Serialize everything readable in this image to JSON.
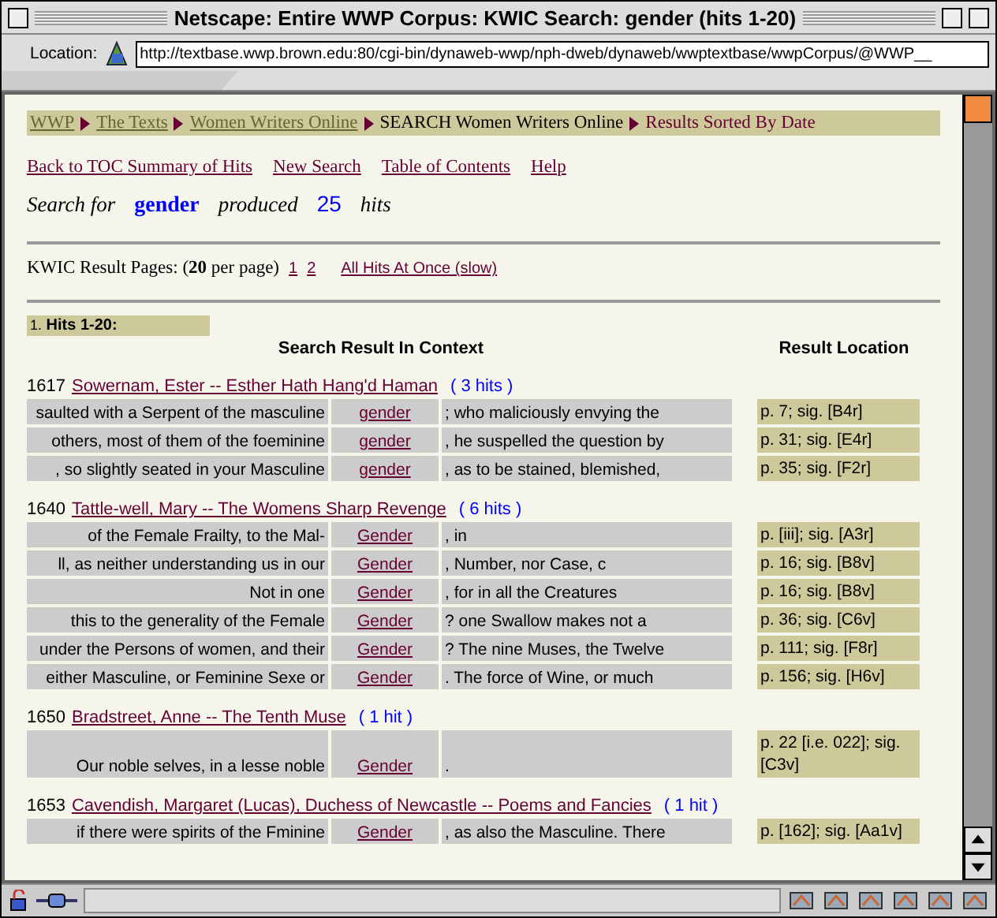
{
  "window": {
    "title": "Netscape: Entire WWP Corpus: KWIC Search: gender (hits 1-20)"
  },
  "location": {
    "label": "Location:",
    "url": "http://textbase.wwp.brown.edu:80/cgi-bin/dynaweb-wwp/nph-dweb/dynaweb/wwptextbase/wwpCorpus/@WWP__"
  },
  "breadcrumb": [
    {
      "label": "WWP",
      "kind": "link"
    },
    {
      "label": "The Texts",
      "kind": "link"
    },
    {
      "label": "Women Writers Online",
      "kind": "link"
    },
    {
      "label": "SEARCH Women Writers Online",
      "kind": "text"
    },
    {
      "label": "Results Sorted By Date",
      "kind": "current"
    }
  ],
  "nav_links": [
    "Back to TOC Summary of Hits",
    "New Search",
    "Table of Contents",
    "Help"
  ],
  "search_summary": {
    "prefix": "Search for",
    "term": "gender",
    "middle": "produced",
    "count": "25",
    "suffix": "hits"
  },
  "result_pages": {
    "label": "KWIC Result Pages: (**20** per page)",
    "pages": [
      "1",
      "2"
    ],
    "all_link": "All Hits At Once (slow)"
  },
  "section": {
    "number": "1.",
    "title": "Hits 1-20:"
  },
  "headers": {
    "context": "Search Result In Context",
    "location": "Result Location"
  },
  "groups": [
    {
      "year": "1617",
      "title": "Sowernam, Ester -- Esther Hath Hang'd Haman",
      "hits": "( 3 hits )",
      "rows": [
        {
          "before": "saulted with a Serpent of the masculine",
          "keyword": "gender",
          "after": "; who maliciously envying the",
          "location": "p. 7; sig. [B4r]"
        },
        {
          "before": "others, most of them of the foeminine",
          "keyword": "gender",
          "after": ", he suspelled the question by",
          "location": "p. 31; sig. [E4r]"
        },
        {
          "before": ", so slightly seated in your Masculine",
          "keyword": "gender",
          "after": ", as to be stained, blemished,",
          "location": "p. 35; sig. [F2r]"
        }
      ]
    },
    {
      "year": "1640",
      "title": "Tattle-well, Mary -- The Womens Sharp Revenge",
      "hits": "( 6 hits )",
      "rows": [
        {
          "before": "of the Female Frailty, to the Mal-",
          "keyword": "Gender",
          "after": ", in",
          "location": "p. [iii]; sig. [A3r]"
        },
        {
          "before": "ll, as neither understanding us in our",
          "keyword": "Gender",
          "after": ", Number, nor Case, c",
          "location": "p. 16; sig. [B8v]"
        },
        {
          "before": "Not in one",
          "keyword": "Gender",
          "after": ", for in all the Creatures",
          "location": "p. 16; sig. [B8v]"
        },
        {
          "before": "this to the generality of the Female",
          "keyword": "Gender",
          "after": "? one Swallow makes not a",
          "location": "p. 36; sig. [C6v]"
        },
        {
          "before": "under the Persons of women, and their",
          "keyword": "Gender",
          "after": "? The nine Muses, the Twelve",
          "location": "p. 111; sig. [F8r]"
        },
        {
          "before": "either Masculine, or Feminine Sexe or",
          "keyword": "Gender",
          "after": ". The force of Wine, or much",
          "location": "p. 156; sig. [H6v]"
        }
      ]
    },
    {
      "year": "1650",
      "title": "Bradstreet, Anne -- The Tenth Muse",
      "hits": "( 1 hit )",
      "rows": [
        {
          "before": "Our noble selves, in a lesse noble",
          "keyword": "Gender",
          "after": ".",
          "location": "p. 22 [i.e. 022]; sig. [C3v]"
        }
      ]
    },
    {
      "year": "1653",
      "title": "Cavendish, Margaret (Lucas), Duchess of Newcastle -- Poems and Fancies",
      "hits": "( 1 hit )",
      "rows": [
        {
          "before": "if there were spirits of the Fminine",
          "keyword": "Gender",
          "after": ", as also the Masculine. There",
          "location": "p. [162]; sig. [Aa1v]"
        }
      ]
    }
  ]
}
